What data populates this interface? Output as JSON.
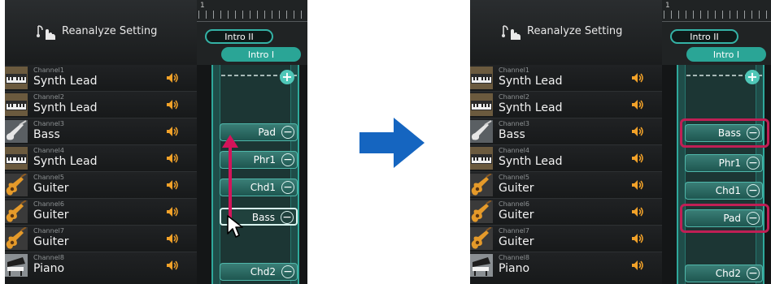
{
  "header": {
    "title": "Reanalyze Setting"
  },
  "timeline": {
    "measure": "1",
    "sections": [
      "Intro II",
      "Intro I"
    ]
  },
  "channels": [
    {
      "number": "Channel1",
      "name": "Synth Lead",
      "icon": "synth-keyboard-icon"
    },
    {
      "number": "Channel2",
      "name": "Synth Lead",
      "icon": "synth-keyboard-icon"
    },
    {
      "number": "Channel3",
      "name": "Bass",
      "icon": "bass-guitar-icon"
    },
    {
      "number": "Channel4",
      "name": "Synth Lead",
      "icon": "synth-keyboard-icon"
    },
    {
      "number": "Channel5",
      "name": "Guiter",
      "icon": "acoustic-guitar-icon"
    },
    {
      "number": "Channel6",
      "name": "Guiter",
      "icon": "acoustic-guitar-icon"
    },
    {
      "number": "Channel7",
      "name": "Guiter",
      "icon": "acoustic-guitar-icon"
    },
    {
      "number": "Channel8",
      "name": "Piano",
      "icon": "piano-icon"
    }
  ],
  "before": {
    "patterns": [
      "Pad",
      "Phr1",
      "Chd1",
      "Bass",
      "Chd2"
    ]
  },
  "after": {
    "patterns": [
      "Bass",
      "Phr1",
      "Chd1",
      "Pad",
      "Chd2"
    ]
  },
  "colors": {
    "accent": "#2aa596",
    "highlight": "#c01f55",
    "arrow": "#1565c0",
    "drag_arrow": "#d4145a"
  }
}
